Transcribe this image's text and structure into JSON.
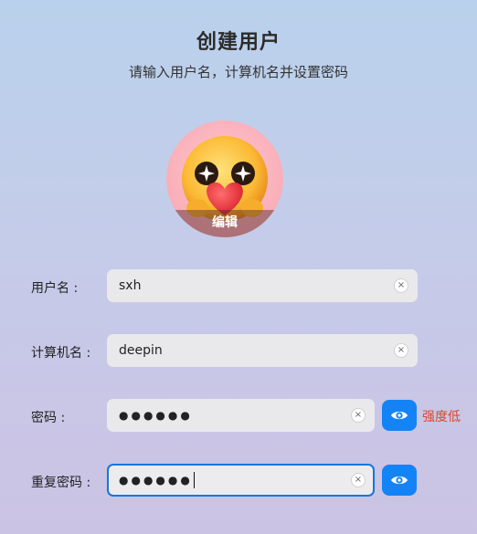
{
  "header": {
    "title": "创建用户",
    "subtitle": "请输入用户名，计算机名并设置密码"
  },
  "avatar": {
    "edit_label": "编辑",
    "icon": "heart-emoji-avatar"
  },
  "form": {
    "username": {
      "label": "用户名 :",
      "value": "sxh"
    },
    "hostname": {
      "label": "计算机名 :",
      "value": "deepin"
    },
    "password": {
      "label": "密码 :",
      "value": "●●●●●●",
      "strength": "强度低"
    },
    "confirm_password": {
      "label": "重复密码 :",
      "value": "●●●●●●"
    },
    "clear_glyph": "×"
  },
  "colors": {
    "accent": "#1483f5",
    "strength_low": "#e0452d"
  }
}
